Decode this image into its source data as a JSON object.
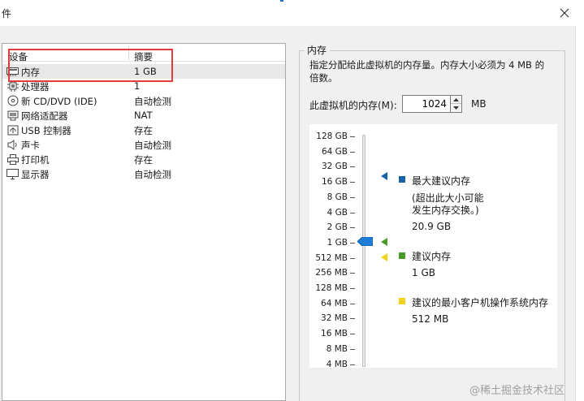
{
  "window": {
    "title": "件"
  },
  "device_list": {
    "headers": {
      "device": "设备",
      "summary": "摘要"
    },
    "items": [
      {
        "icon": "memory-icon",
        "label": "内存",
        "summary": "1 GB",
        "selected": true
      },
      {
        "icon": "cpu-icon",
        "label": "处理器",
        "summary": "1"
      },
      {
        "icon": "cd-dvd-icon",
        "label": "新 CD/DVD (IDE)",
        "summary": "自动检测"
      },
      {
        "icon": "network-icon",
        "label": "网络适配器",
        "summary": "NAT"
      },
      {
        "icon": "usb-icon",
        "label": "USB 控制器",
        "summary": "存在"
      },
      {
        "icon": "sound-icon",
        "label": "声卡",
        "summary": "自动检测"
      },
      {
        "icon": "printer-icon",
        "label": "打印机",
        "summary": "存在"
      },
      {
        "icon": "display-icon",
        "label": "显示器",
        "summary": "自动检测"
      }
    ]
  },
  "memory": {
    "group_title": "内存",
    "description": "指定分配给此虚拟机的内存量。内存大小必须为 4 MB 的倍数。",
    "field_label": "此虚拟机的内存(M):",
    "value": "1024",
    "unit": "MB",
    "slider": {
      "ticks": [
        "128 GB",
        "64 GB",
        "32 GB",
        "16 GB",
        "8 GB",
        "4 GB",
        "2 GB",
        "1 GB",
        "512 MB",
        "256 MB",
        "128 MB",
        "64 MB",
        "32 MB",
        "16 MB",
        "8 MB",
        "4 MB"
      ],
      "current": "1 GB"
    },
    "legend": {
      "max_recommended": {
        "label": "最大建议内存",
        "note_line1": "(超出此大小可能",
        "note_line2": "发生内存交换。)",
        "value": "20.9 GB",
        "color": "#1565a8"
      },
      "recommended": {
        "label": "建议内存",
        "value": "1 GB",
        "color": "#4a9a2a"
      },
      "guest_min": {
        "label": "建议的最小客户机操作系统内存",
        "value": "512 MB",
        "color": "#f2d21a"
      }
    }
  },
  "watermark": "@稀土掘金技术社区",
  "colors": {
    "highlight": "#e03c3c",
    "thumb": "#1e7ed6"
  }
}
